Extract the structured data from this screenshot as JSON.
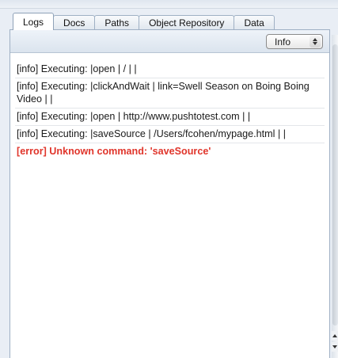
{
  "tabs": [
    {
      "label": "Logs",
      "active": true
    },
    {
      "label": "Docs",
      "active": false
    },
    {
      "label": "Paths",
      "active": false
    },
    {
      "label": "Object Repository",
      "active": false
    },
    {
      "label": "Data",
      "active": false
    }
  ],
  "toolbar": {
    "log_level": {
      "selected": "Info",
      "icon": "up-down-arrows-icon"
    }
  },
  "log": {
    "entries": [
      {
        "level": "info",
        "text": "[info] Executing: |open | / | |"
      },
      {
        "level": "info",
        "text": "[info] Executing: |clickAndWait | link=Swell Season on Boing Boing Video | |"
      },
      {
        "level": "info",
        "text": "[info] Executing: |open | http://www.pushtotest.com | |"
      },
      {
        "level": "info",
        "text": "[info] Executing: |saveSource | /Users/fcohen/mypage.html | |"
      },
      {
        "level": "error",
        "text": "[error] Unknown command: 'saveSource'"
      }
    ]
  },
  "colors": {
    "error_text": "#e0352b",
    "panel_border": "#9fb0c4",
    "toolbar_bg": "#dbe4ee"
  }
}
